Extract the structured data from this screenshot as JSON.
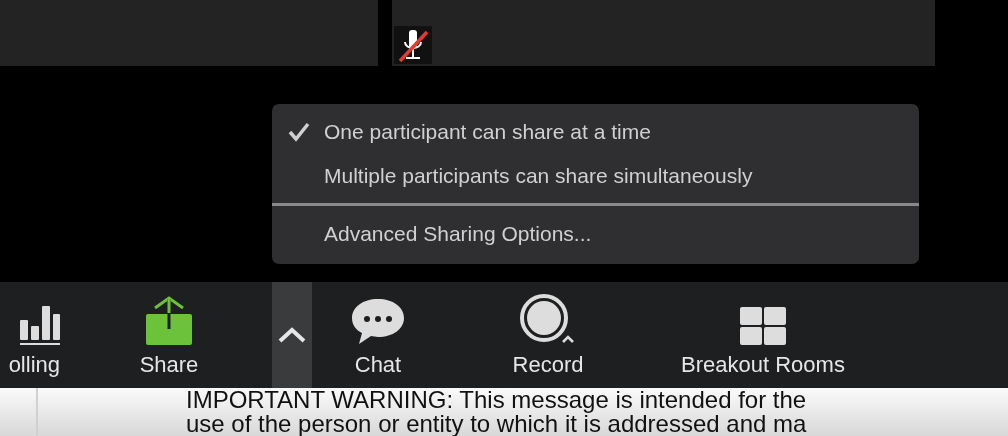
{
  "share_menu": {
    "options": [
      {
        "label": "One participant can share at a time",
        "selected": true
      },
      {
        "label": "Multiple participants can share simultaneously",
        "selected": false
      }
    ],
    "extra_items": [
      {
        "label": "Advanced Sharing Options..."
      }
    ]
  },
  "participant_tiles": [
    {
      "muted": false
    },
    {
      "muted": true
    }
  ],
  "toolbar": {
    "items": [
      {
        "kind": "polling",
        "label": "olling"
      },
      {
        "kind": "share",
        "label": "Share"
      },
      {
        "kind": "share-options"
      },
      {
        "kind": "chat",
        "label": "Chat"
      },
      {
        "kind": "record",
        "label": "Record"
      },
      {
        "kind": "breakout",
        "label": "Breakout Rooms"
      }
    ]
  },
  "document": {
    "lines": [
      "IMPORTANT WARNING: This message is intended for the",
      "use of the person or entity to which it is addressed and ma"
    ]
  }
}
